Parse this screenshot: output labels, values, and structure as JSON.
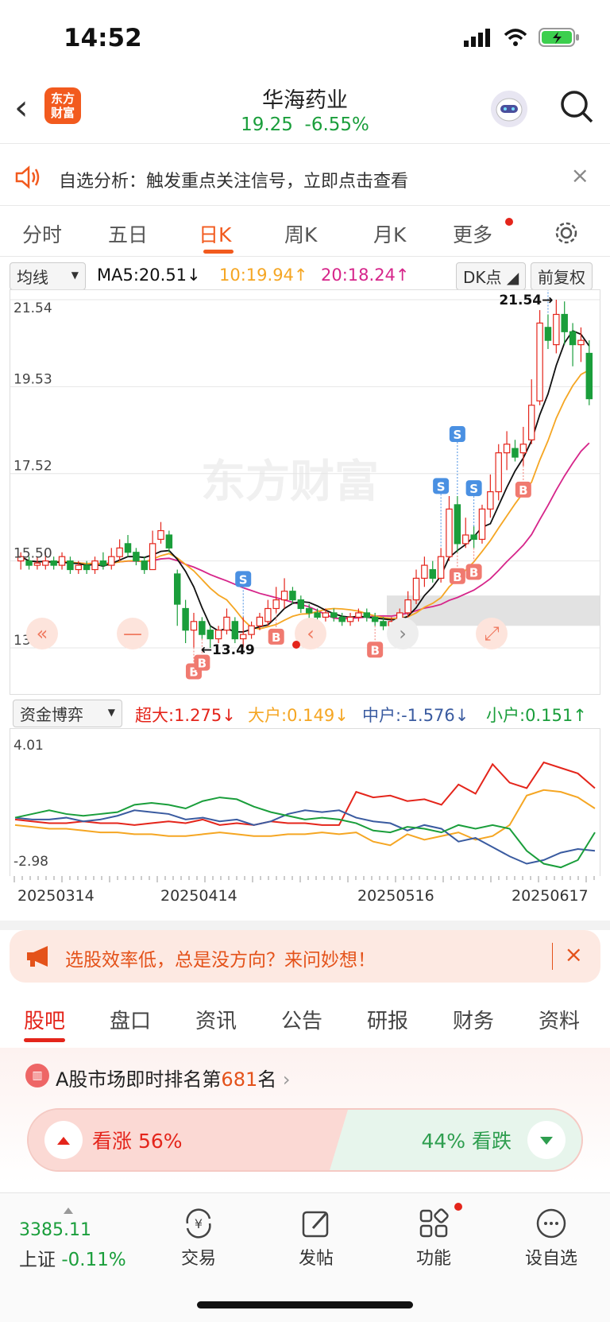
{
  "status": {
    "time": "14:52"
  },
  "header": {
    "logo_line1": "东方",
    "logo_line2": "财富",
    "title": "华海药业",
    "price": "19.25",
    "change": "-6.55%"
  },
  "notice": {
    "text": "自选分析：触发重点关注信号，立即点击查看",
    "close": "×"
  },
  "tabs": [
    {
      "label": "分时"
    },
    {
      "label": "五日"
    },
    {
      "label": "日K"
    },
    {
      "label": "周K"
    },
    {
      "label": "月K"
    },
    {
      "label": "更多"
    }
  ],
  "ma": {
    "selector": "均线",
    "ma5": "MA5:20.51↓",
    "ma10": "10:19.94↑",
    "ma20": "20:18.24↑",
    "dk": "DK点",
    "adjust": "前复权"
  },
  "colors": {
    "up": "#e4251b",
    "down": "#1a9e3b",
    "ma5": "#111111",
    "ma10": "#f5a623",
    "ma20": "#d6258a",
    "accent": "#f25a1e"
  },
  "chart_data": [
    {
      "type": "candlestick",
      "y_labels": [
        "21.54",
        "19.53",
        "17.52",
        "15.50",
        "13.49"
      ],
      "ylim": [
        13.49,
        21.54
      ],
      "max_label": "21.54",
      "min_label": "13.49",
      "candles": [
        [
          15.5,
          15.6,
          15.3,
          15.7
        ],
        [
          15.5,
          15.4,
          15.3,
          15.6
        ],
        [
          15.4,
          15.45,
          15.3,
          15.6
        ],
        [
          15.4,
          15.5,
          15.3,
          15.7
        ],
        [
          15.5,
          15.4,
          15.3,
          15.6
        ],
        [
          15.4,
          15.6,
          15.3,
          15.7
        ],
        [
          15.5,
          15.3,
          15.2,
          15.6
        ],
        [
          15.3,
          15.4,
          15.2,
          15.5
        ],
        [
          15.4,
          15.3,
          15.2,
          15.5
        ],
        [
          15.3,
          15.5,
          15.2,
          15.6
        ],
        [
          15.5,
          15.4,
          15.3,
          15.7
        ],
        [
          15.4,
          15.6,
          15.3,
          15.8
        ],
        [
          15.6,
          15.8,
          15.5,
          16.0
        ],
        [
          15.9,
          15.7,
          15.6,
          16.1
        ],
        [
          15.7,
          15.5,
          15.4,
          15.8
        ],
        [
          15.5,
          15.3,
          15.2,
          15.6
        ],
        [
          15.3,
          15.9,
          15.3,
          16.2
        ],
        [
          16.0,
          16.2,
          15.9,
          16.4
        ],
        [
          16.1,
          15.8,
          15.7,
          16.2
        ],
        [
          15.2,
          14.5,
          14.0,
          15.3
        ],
        [
          14.4,
          13.9,
          13.6,
          14.6
        ],
        [
          13.9,
          14.1,
          13.5,
          14.3
        ],
        [
          14.1,
          13.8,
          13.7,
          14.2
        ],
        [
          13.9,
          13.7,
          13.49,
          14.0
        ],
        [
          13.7,
          13.9,
          13.6,
          14.0
        ],
        [
          13.9,
          14.2,
          13.8,
          14.4
        ],
        [
          14.1,
          13.7,
          13.6,
          14.2
        ],
        [
          13.7,
          13.8,
          13.5,
          14.2
        ],
        [
          13.8,
          14.0,
          13.7,
          14.1
        ],
        [
          14.0,
          14.2,
          13.9,
          14.3
        ],
        [
          14.1,
          14.4,
          14.0,
          14.6
        ],
        [
          14.4,
          14.6,
          14.3,
          14.9
        ],
        [
          14.6,
          14.8,
          14.4,
          15.1
        ],
        [
          14.8,
          14.6,
          14.5,
          14.9
        ],
        [
          14.6,
          14.4,
          14.3,
          14.7
        ],
        [
          14.4,
          14.3,
          14.1,
          14.5
        ],
        [
          14.3,
          14.2,
          14.0,
          14.4
        ],
        [
          14.2,
          14.3,
          14.1,
          14.4
        ],
        [
          14.3,
          14.2,
          14.1,
          14.4
        ],
        [
          14.2,
          14.1,
          14.0,
          14.3
        ],
        [
          14.1,
          14.2,
          14.0,
          14.3
        ],
        [
          14.2,
          14.3,
          14.1,
          14.4
        ],
        [
          14.3,
          14.2,
          14.1,
          14.4
        ],
        [
          14.2,
          14.1,
          14.0,
          14.3
        ],
        [
          14.1,
          14.0,
          13.9,
          14.2
        ],
        [
          14.0,
          14.1,
          13.9,
          14.2
        ],
        [
          14.1,
          14.3,
          14.0,
          14.4
        ],
        [
          14.3,
          14.6,
          14.2,
          14.8
        ],
        [
          14.6,
          15.1,
          14.5,
          15.3
        ],
        [
          15.1,
          15.4,
          14.9,
          15.6
        ],
        [
          15.3,
          15.1,
          15.0,
          15.5
        ],
        [
          15.1,
          15.6,
          15.0,
          15.8
        ],
        [
          15.6,
          16.7,
          15.5,
          17.0
        ],
        [
          16.8,
          15.9,
          15.7,
          17.0
        ],
        [
          15.9,
          16.1,
          15.8,
          16.5
        ],
        [
          16.1,
          16.0,
          15.8,
          16.3
        ],
        [
          16.0,
          16.7,
          15.9,
          16.8
        ],
        [
          16.7,
          17.1,
          16.5,
          17.5
        ],
        [
          17.1,
          18.0,
          16.9,
          18.2
        ],
        [
          18.0,
          18.2,
          17.6,
          18.5
        ],
        [
          18.1,
          17.9,
          17.8,
          18.3
        ],
        [
          18.0,
          18.2,
          17.7,
          18.6
        ],
        [
          18.3,
          19.1,
          18.2,
          19.7
        ],
        [
          19.2,
          21.0,
          19.1,
          21.3
        ],
        [
          20.9,
          20.6,
          20.4,
          21.2
        ],
        [
          20.5,
          21.2,
          20.3,
          21.54
        ],
        [
          21.2,
          20.8,
          20.5,
          21.5
        ],
        [
          20.8,
          20.5,
          20.0,
          21.0
        ],
        [
          20.5,
          20.6,
          20.1,
          20.9
        ],
        [
          20.3,
          19.25,
          19.1,
          20.6
        ]
      ],
      "signals": [
        {
          "type": "S",
          "index": 27
        },
        {
          "type": "B",
          "index": 21
        },
        {
          "type": "B",
          "index": 22
        },
        {
          "type": "B",
          "index": 31
        },
        {
          "type": "B",
          "index": 43
        },
        {
          "type": "S",
          "index": 51
        },
        {
          "type": "B",
          "index": 53
        },
        {
          "type": "S",
          "index": 53
        },
        {
          "type": "S",
          "index": 55
        },
        {
          "type": "B",
          "index": 55
        },
        {
          "type": "B",
          "index": 61
        },
        {
          "type": "S",
          "index": 64
        }
      ]
    },
    {
      "type": "line",
      "title": "资金博弈",
      "y_labels": [
        "4.01",
        "-2.98"
      ],
      "ylim": [
        -2.98,
        4.01
      ],
      "x_labels": [
        "20250314",
        "20250414",
        "20250516",
        "20250617"
      ],
      "series": [
        {
          "name": "超大:1.275↓",
          "color": "#e4251b",
          "values": [
            -0.3,
            -0.4,
            -0.5,
            -0.5,
            -0.4,
            -0.5,
            -0.5,
            -0.6,
            -0.5,
            -0.4,
            -0.5,
            -0.3,
            -0.6,
            -0.5,
            -0.6,
            -0.4,
            -0.5,
            -0.5,
            -0.6,
            -0.6,
            1.2,
            0.9,
            1.0,
            0.7,
            0.8,
            0.5,
            1.6,
            1.1,
            2.7,
            1.7,
            1.4,
            2.8,
            2.5,
            2.2,
            1.4
          ]
        },
        {
          "name": "大户:0.149↓",
          "color": "#f5a623",
          "values": [
            -0.6,
            -0.7,
            -0.8,
            -0.8,
            -0.9,
            -1.0,
            -1.0,
            -1.1,
            -1.1,
            -1.2,
            -1.2,
            -1.1,
            -1.0,
            -1.1,
            -1.2,
            -1.2,
            -1.1,
            -1.1,
            -1.0,
            -1.1,
            -1.0,
            -1.5,
            -1.7,
            -1.1,
            -1.4,
            -1.2,
            -1.0,
            -1.4,
            -1.2,
            -0.6,
            1.0,
            1.3,
            1.2,
            0.9,
            0.3
          ]
        },
        {
          "name": "中户:-1.576↓",
          "color": "#3a5ba0",
          "values": [
            -0.2,
            -0.3,
            -0.3,
            -0.2,
            -0.4,
            -0.3,
            -0.1,
            0.2,
            0.1,
            0.0,
            -0.3,
            -0.2,
            -0.4,
            -0.3,
            -0.6,
            -0.4,
            0.0,
            0.2,
            0.1,
            0.2,
            -0.2,
            -0.4,
            -0.5,
            -0.9,
            -0.6,
            -0.8,
            -1.5,
            -1.3,
            -1.8,
            -2.3,
            -2.7,
            -2.5,
            -2.1,
            -1.9,
            -2.0
          ]
        },
        {
          "name": "小户:0.151↑",
          "color": "#1a9e3b",
          "values": [
            -0.2,
            0.0,
            0.2,
            0.0,
            -0.1,
            0.0,
            0.1,
            0.5,
            0.6,
            0.5,
            0.3,
            0.7,
            0.9,
            0.8,
            0.4,
            0.1,
            -0.1,
            -0.3,
            -0.2,
            -0.3,
            -0.5,
            -0.9,
            -1.0,
            -0.7,
            -0.8,
            -1.0,
            -0.6,
            -0.8,
            -0.6,
            -0.8,
            -2.0,
            -2.7,
            -2.9,
            -2.5,
            -1.0
          ]
        }
      ]
    }
  ],
  "watermark": "东方财富",
  "promo": {
    "text": "选股效率低，总是没方向？来问妙想！",
    "close": "×"
  },
  "bottom_tabs": [
    {
      "label": "股吧"
    },
    {
      "label": "盘口"
    },
    {
      "label": "资讯"
    },
    {
      "label": "公告"
    },
    {
      "label": "研报"
    },
    {
      "label": "财务"
    },
    {
      "label": "资料"
    }
  ],
  "rank": {
    "prefix": "A股市场即时排名第",
    "number": "681",
    "suffix": "名"
  },
  "vote": {
    "up_label": "看涨 56%",
    "down_label": "44% 看跌",
    "up_fraction": 0.56
  },
  "bottom_bar": {
    "index_value": "3385.11",
    "index_name": "上证",
    "index_change": "-0.11%",
    "trade": "交易",
    "post": "发帖",
    "function": "功能",
    "set_watch": "设自选"
  }
}
